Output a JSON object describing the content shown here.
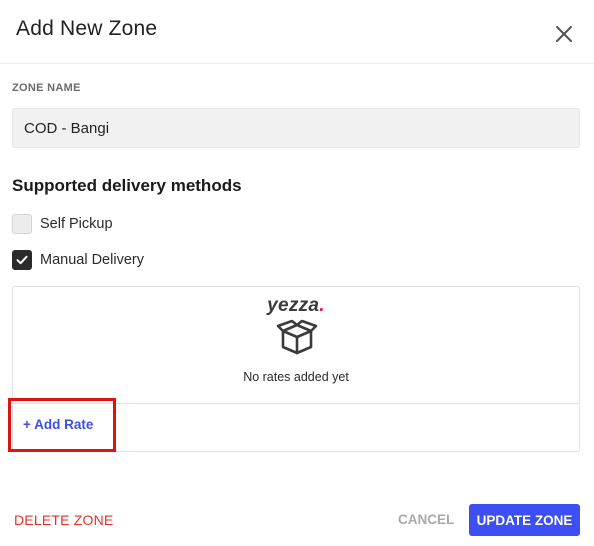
{
  "dialog": {
    "title": "Add New Zone",
    "close_icon": "close-icon"
  },
  "zone_name": {
    "label": "ZONE NAME",
    "value": "COD - Bangi"
  },
  "delivery_methods": {
    "title": "Supported delivery methods",
    "options": [
      {
        "label": "Self Pickup",
        "checked": false
      },
      {
        "label": "Manual Delivery",
        "checked": true
      }
    ]
  },
  "rates": {
    "brand_text": "yezza",
    "brand_dot": ".",
    "empty_icon": "box-icon",
    "empty_text": "No rates added yet",
    "add_rate_label": "+ Add Rate"
  },
  "footer": {
    "delete_label": "DELETE ZONE",
    "cancel_label": "CANCEL",
    "update_label": "UPDATE ZONE"
  },
  "colors": {
    "accent": "#3d4ef2",
    "danger": "#e5322d",
    "brand_dot": "#d81b60",
    "highlight": "#e0120f"
  }
}
